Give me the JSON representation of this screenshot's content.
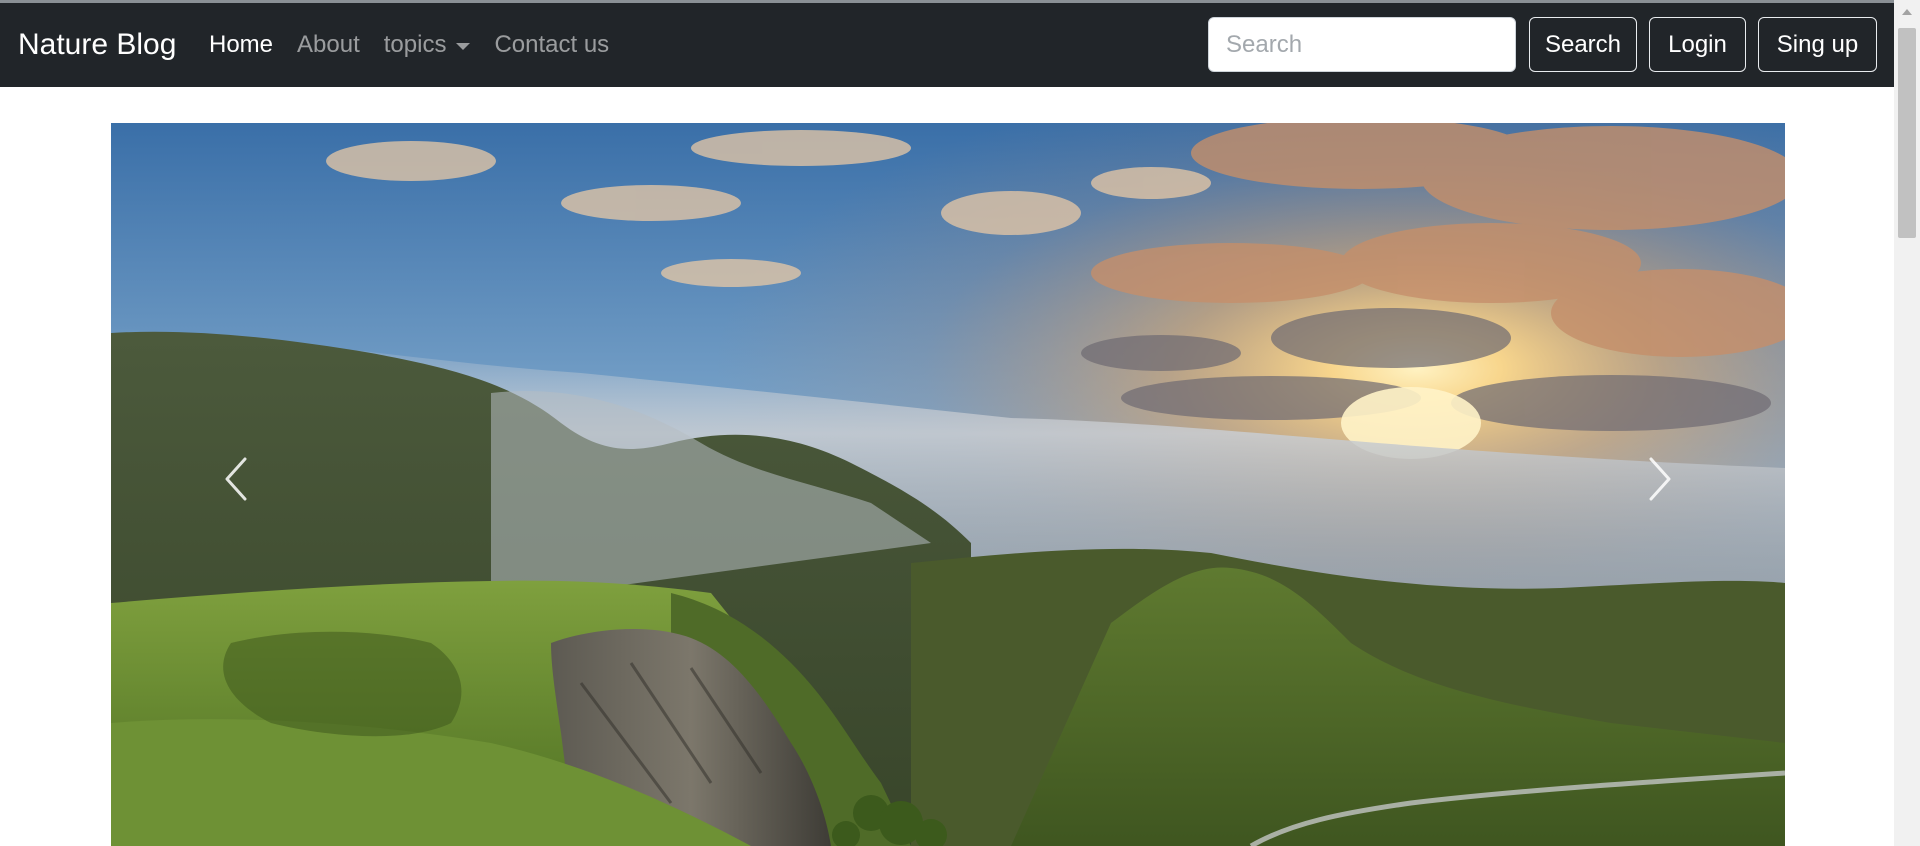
{
  "navbar": {
    "brand": "Nature Blog",
    "links": [
      {
        "label": "Home",
        "active": true
      },
      {
        "label": "About",
        "active": false
      },
      {
        "label": "topics",
        "active": false,
        "dropdown": true
      },
      {
        "label": "Contact us",
        "active": false
      }
    ],
    "search": {
      "placeholder": "Search",
      "value": "",
      "button_label": "Search"
    },
    "login_label": "Login",
    "signup_label": "Sing up"
  },
  "carousel": {
    "slide": {
      "alt": "Mountain valley with fog and sunset over green hills"
    },
    "prev_icon": "chevron-left-icon",
    "next_icon": "chevron-right-icon"
  },
  "colors": {
    "navbar_bg": "#212529",
    "nav_active": "#ffffff",
    "nav_inactive": "rgba(255,255,255,0.55)",
    "sky_top": "#3a6fa8",
    "sun": "#ffd98a",
    "hills": "#5c7a32"
  }
}
